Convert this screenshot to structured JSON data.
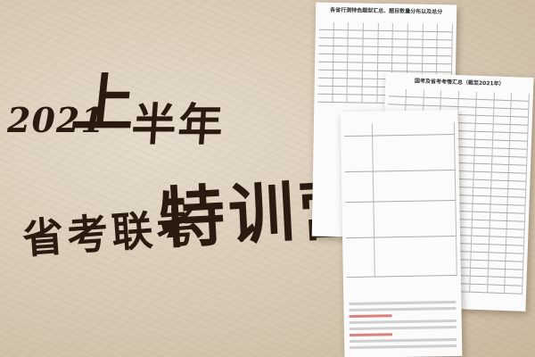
{
  "title": {
    "year": "2021",
    "half_year_char": "上",
    "half_year_rest": "半年",
    "subtitle_left": "省考联考",
    "subtitle_right": "特训营"
  },
  "docs": {
    "doc1_heading": "各省行测特色题型汇总、题目数量分布以及总分",
    "doc2_heading": "国考及省考考情汇总（截至2021年）"
  },
  "colors": {
    "background": "#d9ccba",
    "ink": "#2a1b10",
    "paper": "#fbfbfb",
    "accent_red": "#c0241c"
  }
}
